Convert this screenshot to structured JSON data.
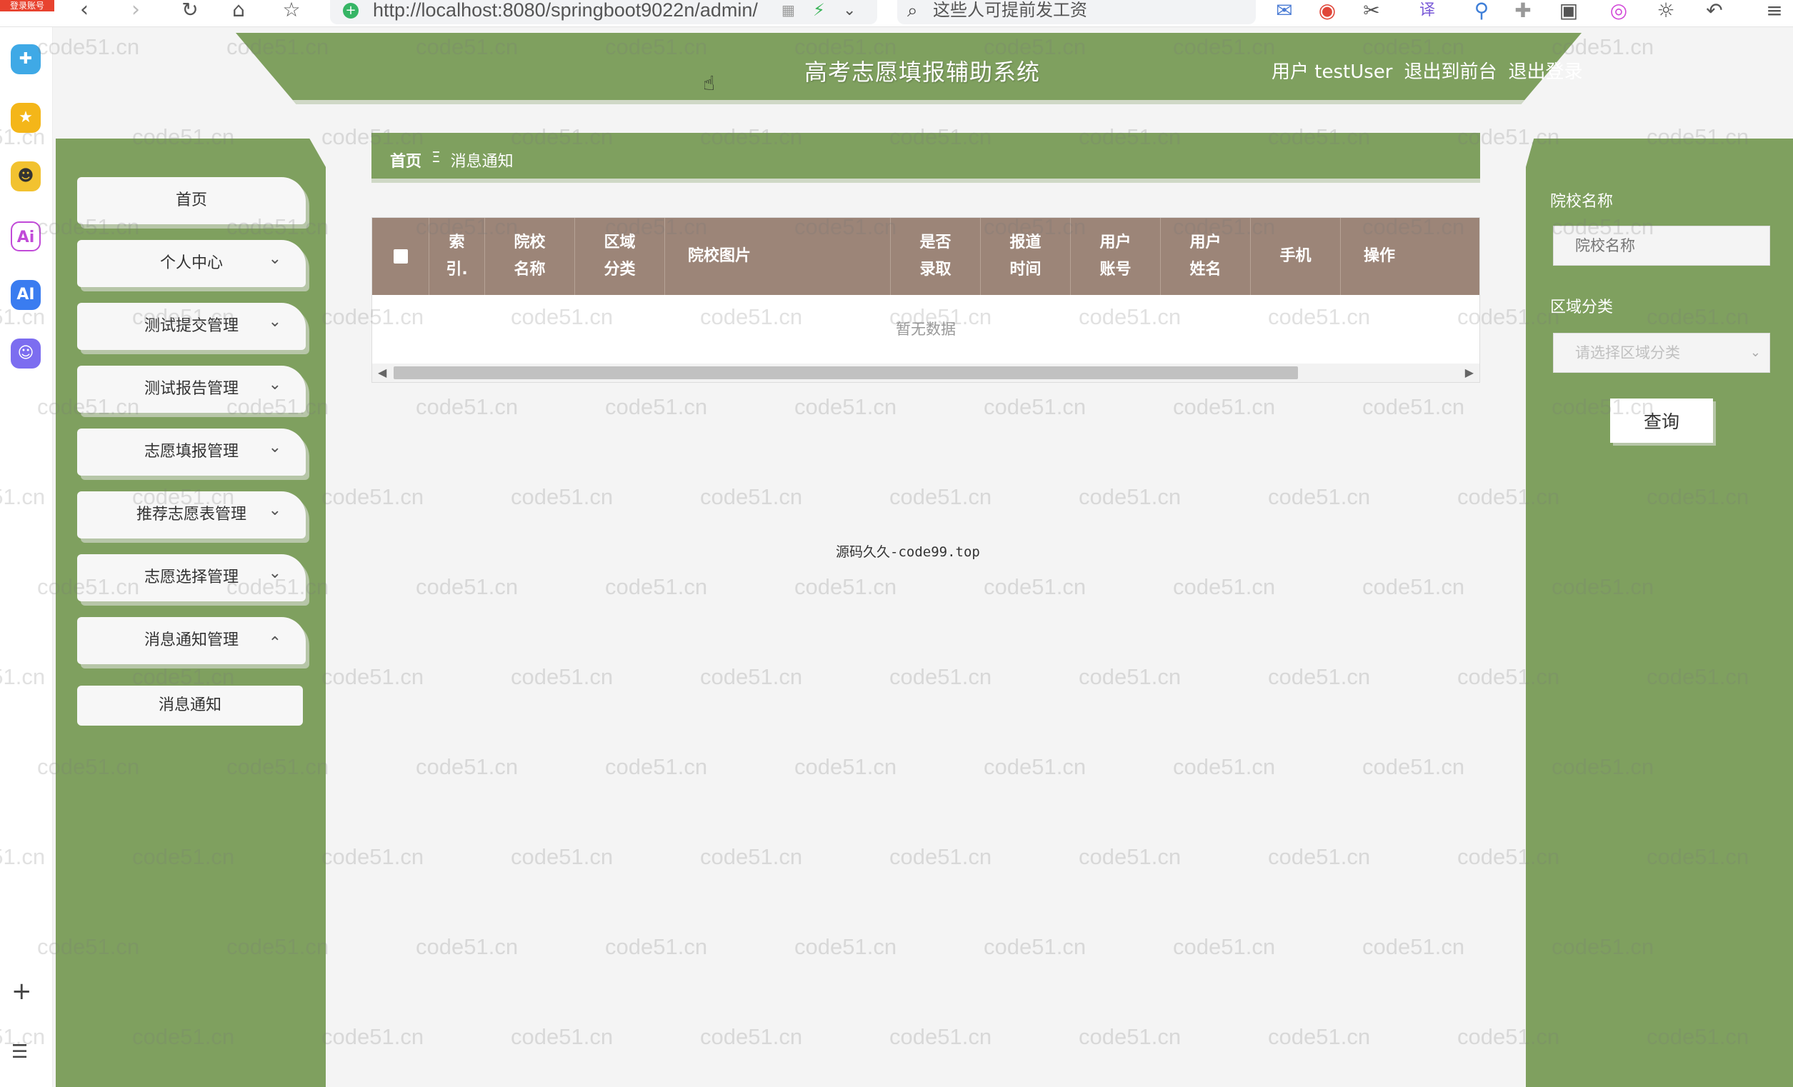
{
  "browser": {
    "corner_badge": "登录账号",
    "url": "http://localhost:8080/springboot9022n/admin/",
    "search_placeholder": "这些人可提前发工资"
  },
  "app": {
    "title": "高考志愿填报辅助系统",
    "user_prefix": "用户",
    "username": "testUser",
    "back_to_front": "退出到前台",
    "logout": "退出登录"
  },
  "sidebar": {
    "items": [
      {
        "label": "首页",
        "expandable": false
      },
      {
        "label": "个人中心",
        "expandable": true
      },
      {
        "label": "测试提交管理",
        "expandable": true
      },
      {
        "label": "测试报告管理",
        "expandable": true
      },
      {
        "label": "志愿填报管理",
        "expandable": true
      },
      {
        "label": "推荐志愿表管理",
        "expandable": true
      },
      {
        "label": "志愿选择管理",
        "expandable": true
      },
      {
        "label": "消息通知管理",
        "expandable": true,
        "expanded": true
      }
    ],
    "sub_item": "消息通知"
  },
  "breadcrumb": {
    "home": "首页",
    "separator": "Ξ",
    "current": "消息通知"
  },
  "table": {
    "headers": [
      "",
      "索\n引.",
      "院校\n名称",
      "区域\n分类",
      "院校图片",
      "是否\n录取",
      "报道\n时间",
      "用户\n账号",
      "用户\n姓名",
      "手机",
      "操作"
    ],
    "empty_text": "暂无数据"
  },
  "filters": {
    "school_label": "院校名称",
    "school_placeholder": "院校名称",
    "region_label": "区域分类",
    "region_placeholder": "请选择区域分类",
    "query_button": "查询"
  },
  "footer_note": "源码久久-code99.top",
  "watermark": "code51.cn",
  "colors": {
    "green": "#7fa05f",
    "table_header": "#9c8578"
  }
}
